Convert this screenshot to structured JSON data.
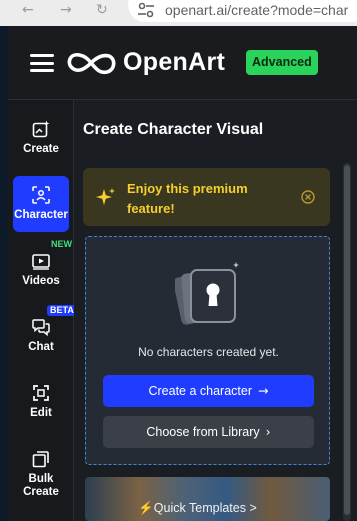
{
  "browser": {
    "back_icon": "arrow-left-icon",
    "forward_icon": "arrow-right-icon",
    "reload_icon": "reload-icon",
    "url": "openart.ai/create?mode=char"
  },
  "header": {
    "logo_text": "OpenArt",
    "badge": "Advanced",
    "badge_color": "#2ad35a"
  },
  "sidebar": {
    "items": [
      {
        "label": "Create",
        "icon": "image-sparkle-icon"
      },
      {
        "label": "Character",
        "icon": "face-scan-icon",
        "active": true
      },
      {
        "label": "Videos",
        "icon": "video-play-icon",
        "tag": "NEW"
      },
      {
        "label": "Chat",
        "icon": "chat-bubbles-icon",
        "tag": "BETA"
      },
      {
        "label": "Edit",
        "icon": "edit-frame-icon"
      },
      {
        "label": "Bulk Create",
        "icon": "stacked-squares-icon"
      }
    ]
  },
  "main": {
    "title": "Create Character Visual",
    "premium_text": "Enjoy this premium feature!",
    "empty_text": "No characters created yet.",
    "create_button": "Create a character",
    "library_button": "Choose from Library",
    "templates_label": "⚡Quick Templates >"
  },
  "colors": {
    "accent": "#1f3cff",
    "premium_text": "#f4cf2d",
    "new_tag": "#3ee07c"
  }
}
